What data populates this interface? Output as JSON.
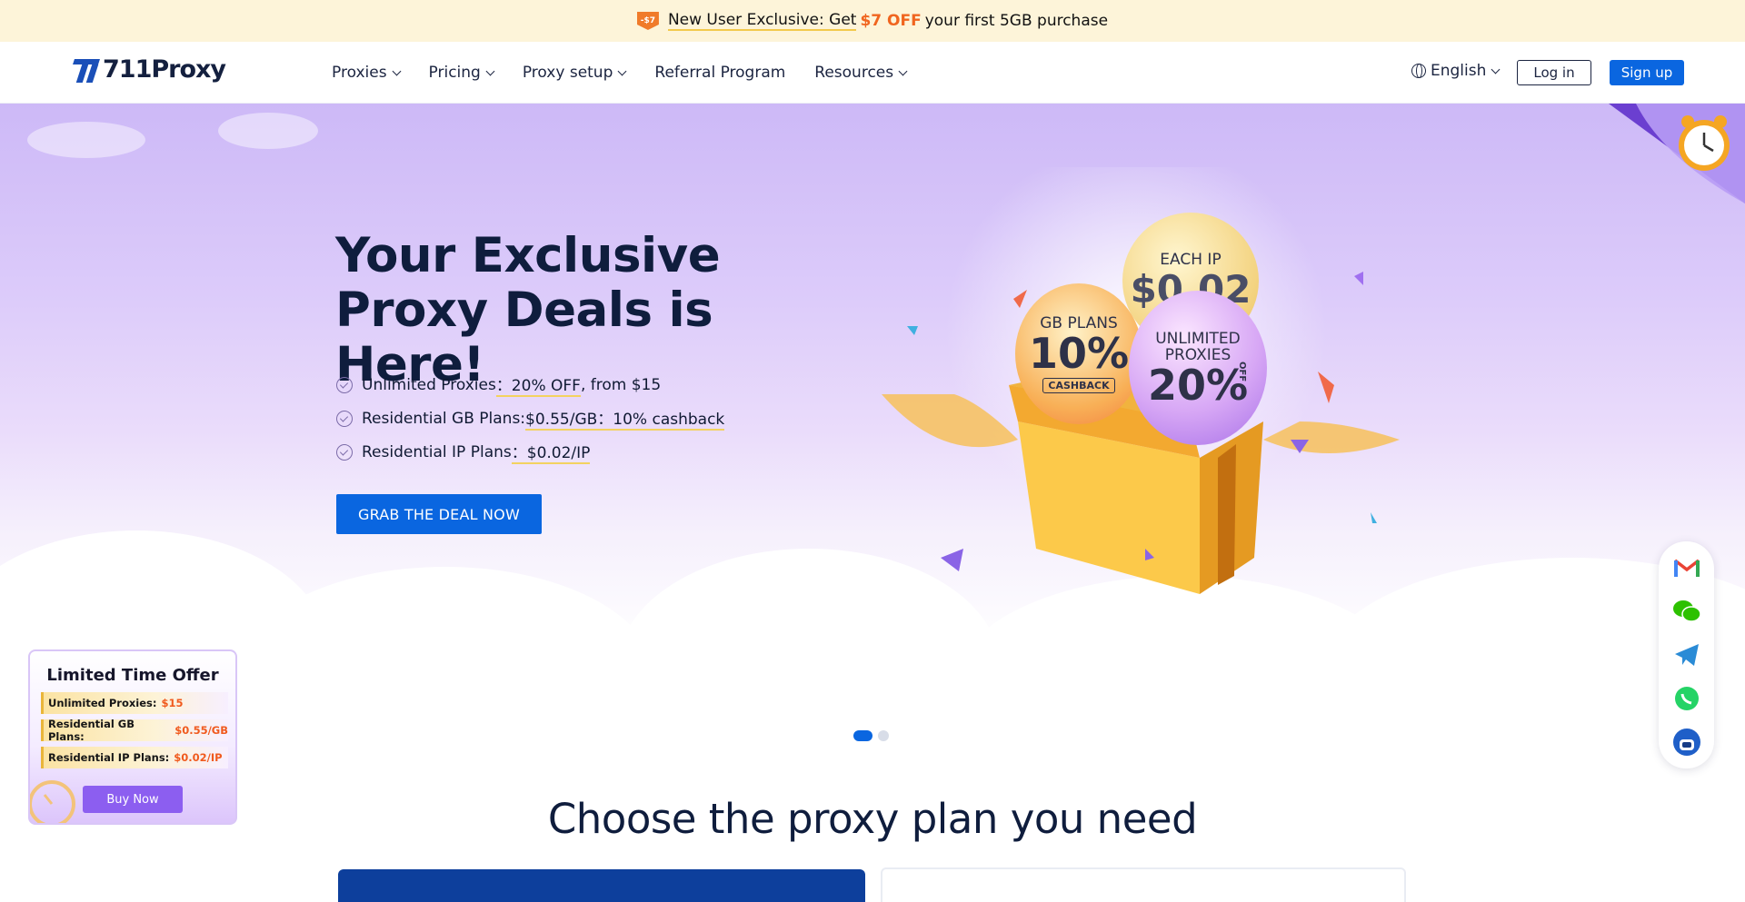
{
  "announcement": {
    "tag_icon": "discount-tag-icon",
    "tag_text": "-$7",
    "prefix": "New User Exclusive: Get",
    "highlight": "$7 OFF",
    "suffix": "your first 5GB purchase"
  },
  "nav": {
    "logo_text": "711Proxy",
    "items": [
      {
        "label": "Proxies",
        "dropdown": true
      },
      {
        "label": "Pricing",
        "dropdown": true
      },
      {
        "label": "Proxy setup",
        "dropdown": true
      },
      {
        "label": "Referral Program",
        "dropdown": false
      },
      {
        "label": "Resources",
        "dropdown": true
      }
    ],
    "language": "English",
    "login_label": "Log in",
    "signup_label": "Sign up"
  },
  "hero": {
    "title": "Your Exclusive Proxy Deals is Here!",
    "features": [
      {
        "lead": "Unlimited Proxies",
        "highlight": "：20% OFF",
        "tail": ", from $15"
      },
      {
        "lead": "Residential GB Plans: ",
        "highlight": "$0.55/GB：10% cashback",
        "tail": ""
      },
      {
        "lead": "Residential IP Plans",
        "highlight": "：$0.02/IP",
        "tail": ""
      }
    ],
    "cta_label": "GRAB THE DEAL NOW",
    "balloons": {
      "ip": {
        "line1": "EACH IP",
        "value": "$0.02"
      },
      "gb": {
        "line1": "GB PLANS",
        "value": "10%",
        "badge": "CASHBACK"
      },
      "unlimited": {
        "line1": "UNLIMITED",
        "line2": "PROXIES",
        "value": "20%",
        "side": "OFF"
      }
    }
  },
  "carousel": {
    "slide_count": 2,
    "active_index": 0
  },
  "offer": {
    "title": "Limited Time Offer",
    "rows": [
      {
        "label": "Unlimited Proxies:",
        "price": "$15"
      },
      {
        "label": "Residential GB Plans:",
        "price": "$0.55/GB"
      },
      {
        "label": "Residential IP Plans:",
        "price": "$0.02/IP"
      }
    ],
    "buy_label": "Buy Now"
  },
  "social": [
    "gmail-icon",
    "wechat-icon",
    "telegram-icon",
    "whatsapp-icon",
    "support-bot-icon"
  ],
  "plans": {
    "title": "Choose the proxy plan you need"
  },
  "colors": {
    "accent": "#0a66e0",
    "highlight_orange": "#f0651f",
    "banner_bg": "#fdf4d9",
    "offer_purple": "#8c5ef0"
  }
}
